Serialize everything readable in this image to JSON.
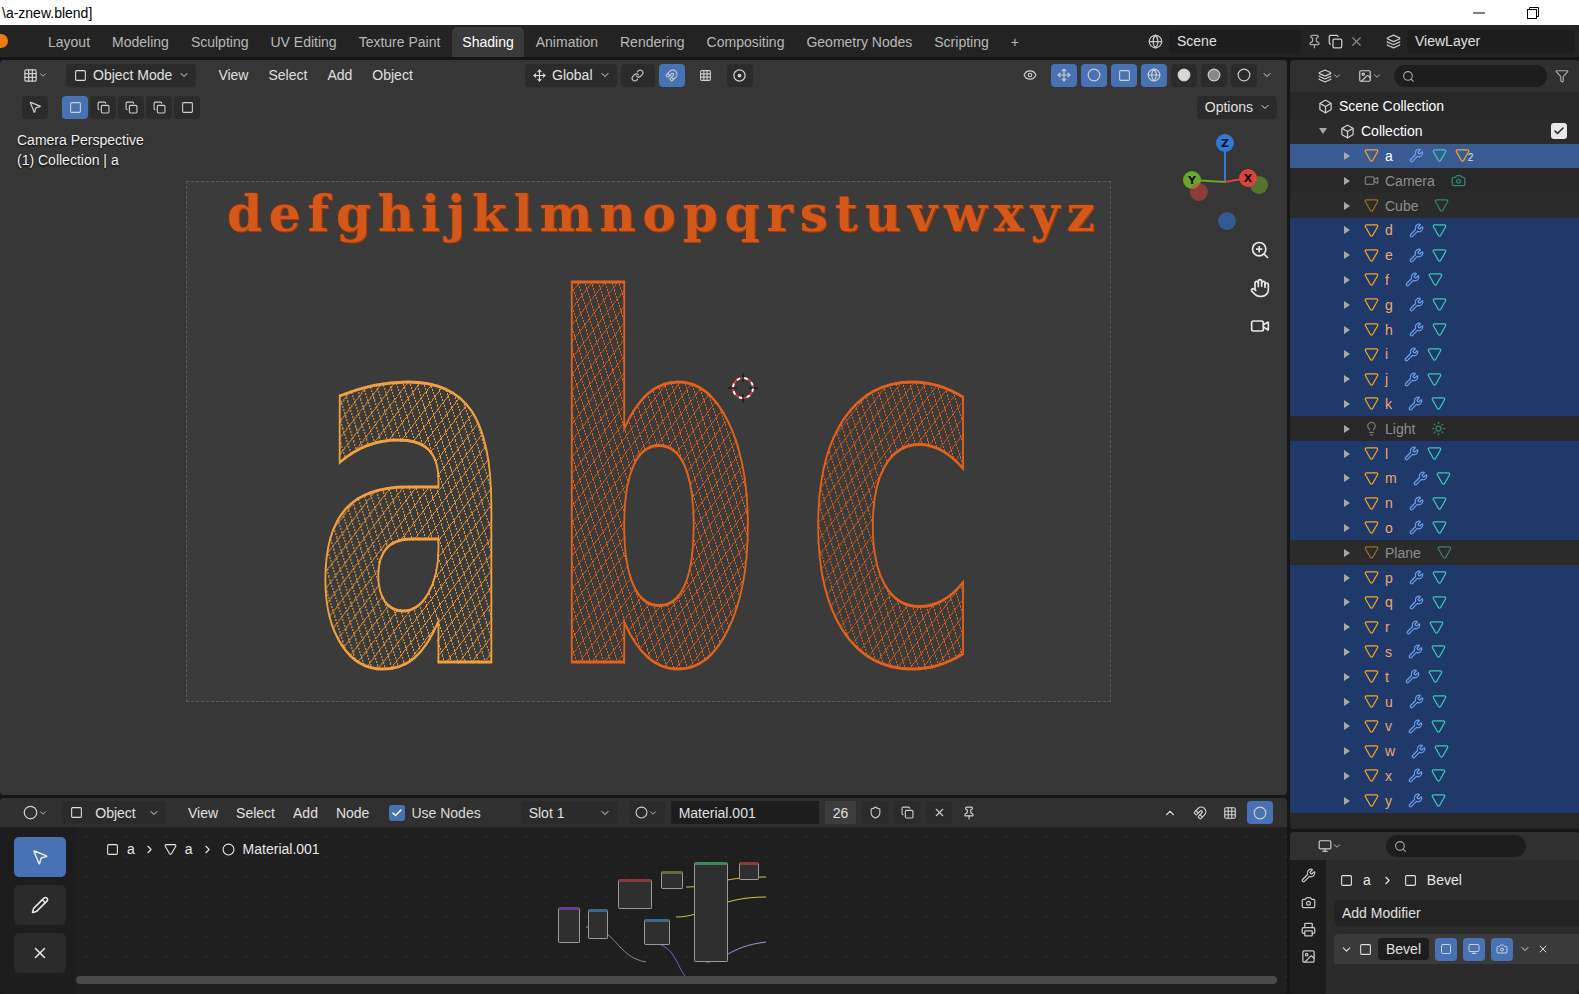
{
  "window": {
    "title": "\\a-znew.blend]"
  },
  "workspaces": [
    {
      "label": "Layout",
      "selected": false
    },
    {
      "label": "Modeling",
      "selected": false
    },
    {
      "label": "Sculpting",
      "selected": false
    },
    {
      "label": "UV Editing",
      "selected": false
    },
    {
      "label": "Texture Paint",
      "selected": false
    },
    {
      "label": "Shading",
      "selected": true
    },
    {
      "label": "Animation",
      "selected": false
    },
    {
      "label": "Rendering",
      "selected": false
    },
    {
      "label": "Compositing",
      "selected": false
    },
    {
      "label": "Geometry Nodes",
      "selected": false
    },
    {
      "label": "Scripting",
      "selected": false
    }
  ],
  "add_workspace": "+",
  "scene": "Scene",
  "view_layer": "ViewLayer",
  "viewport": {
    "mode": "Object Mode",
    "menus": [
      "View",
      "Select",
      "Add",
      "Object"
    ],
    "orientation": "Global",
    "options": "Options",
    "overlay_lines": [
      "Camera Perspective",
      "(1) Collection | a"
    ],
    "gizmo": [
      {
        "label": "Z",
        "color": "#2f79d8"
      },
      {
        "label": "Y",
        "color": "#6aa82a"
      },
      {
        "label": "X",
        "color": "#d9443f"
      }
    ],
    "scene_letters": [
      "d",
      "e",
      "f",
      "g",
      "h",
      "i",
      "j",
      "k",
      "l",
      "m",
      "n",
      "o",
      "p",
      "q",
      "r",
      "s",
      "t",
      "u",
      "v",
      "w",
      "x",
      "y",
      "z"
    ],
    "large_letters": [
      {
        "label": "a",
        "selected": true
      },
      {
        "label": "b",
        "selected": false
      },
      {
        "label": "c",
        "selected": false
      }
    ]
  },
  "node_editor": {
    "type": "Object",
    "menus": [
      "View",
      "Select",
      "Add",
      "Node"
    ],
    "use_nodes": {
      "label": "Use Nodes",
      "checked": true
    },
    "slot": "Slot 1",
    "material": "Material.001",
    "users": "26",
    "breadcrumb": [
      "a",
      "a",
      "Material.001"
    ]
  },
  "outliner": {
    "root": "Scene Collection",
    "collection": {
      "label": "Collection",
      "checked": true
    },
    "items": [
      {
        "name": "a",
        "kind": "modified",
        "selected": true,
        "active": true,
        "badge": "2"
      },
      {
        "name": "Camera",
        "kind": "camera",
        "selected": false,
        "active": false
      },
      {
        "name": "Cube",
        "kind": "mesh",
        "selected": false,
        "active": false
      },
      {
        "name": "d",
        "kind": "modified",
        "selected": true,
        "active": false
      },
      {
        "name": "e",
        "kind": "modified",
        "selected": true,
        "active": false
      },
      {
        "name": "f",
        "kind": "modified",
        "selected": true,
        "active": false
      },
      {
        "name": "g",
        "kind": "modified",
        "selected": true,
        "active": false
      },
      {
        "name": "h",
        "kind": "modified",
        "selected": true,
        "active": false
      },
      {
        "name": "i",
        "kind": "modified",
        "selected": true,
        "active": false
      },
      {
        "name": "j",
        "kind": "modified",
        "selected": true,
        "active": false
      },
      {
        "name": "k",
        "kind": "modified",
        "selected": true,
        "active": false
      },
      {
        "name": "Light",
        "kind": "light",
        "selected": false,
        "active": false
      },
      {
        "name": "l",
        "kind": "modified",
        "selected": true,
        "active": false
      },
      {
        "name": "m",
        "kind": "modified",
        "selected": true,
        "active": false
      },
      {
        "name": "n",
        "kind": "modified",
        "selected": true,
        "active": false
      },
      {
        "name": "o",
        "kind": "modified",
        "selected": true,
        "active": false
      },
      {
        "name": "Plane",
        "kind": "mesh",
        "selected": false,
        "active": false
      },
      {
        "name": "p",
        "kind": "modified",
        "selected": true,
        "active": false
      },
      {
        "name": "q",
        "kind": "modified",
        "selected": true,
        "active": false
      },
      {
        "name": "r",
        "kind": "modified",
        "selected": true,
        "active": false
      },
      {
        "name": "s",
        "kind": "modified",
        "selected": true,
        "active": false
      },
      {
        "name": "t",
        "kind": "modified",
        "selected": true,
        "active": false
      },
      {
        "name": "u",
        "kind": "modified",
        "selected": true,
        "active": false
      },
      {
        "name": "v",
        "kind": "modified",
        "selected": true,
        "active": false
      },
      {
        "name": "w",
        "kind": "modified",
        "selected": true,
        "active": false
      },
      {
        "name": "x",
        "kind": "modified",
        "selected": true,
        "active": false
      },
      {
        "name": "y",
        "kind": "modified",
        "selected": true,
        "active": false
      }
    ]
  },
  "properties": {
    "breadcrumb": [
      "a",
      "Bevel"
    ],
    "add_modifier": "Add Modifier",
    "modifier": "Bevel"
  }
}
